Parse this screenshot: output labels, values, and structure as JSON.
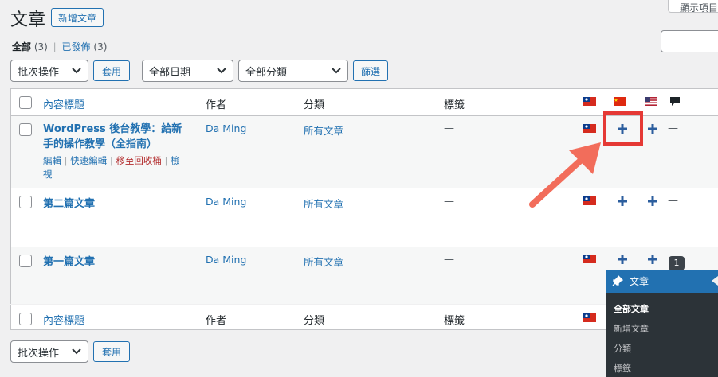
{
  "header": {
    "title": "文章",
    "add_new": "新增文章",
    "screen_options": "顯示項目"
  },
  "subsubsub": {
    "all_label": "全部",
    "all_count": "(3)",
    "sep": "|",
    "published_label": "已發佈",
    "published_count": "(3)"
  },
  "filters_top": {
    "bulk_action": "批次操作",
    "apply": "套用",
    "date": "全部日期",
    "category": "全部分類",
    "filter": "篩選"
  },
  "table": {
    "col_title": "內容標題",
    "col_author": "作者",
    "col_categories": "分類",
    "col_tags": "標籤",
    "rows": [
      {
        "title": "WordPress 後台教學：給新手的操作教學（全指南）",
        "author": "Da Ming",
        "category": "所有文章",
        "tags": "—",
        "actions": {
          "edit": "編輯",
          "quick_edit": "快速編輯",
          "trash": "移至回收桶",
          "view": "檢視"
        },
        "extra": "—"
      },
      {
        "title": "第二篇文章",
        "author": "Da Ming",
        "category": "所有文章",
        "tags": "—",
        "extra": "—"
      },
      {
        "title": "第一篇文章",
        "author": "Da Ming",
        "category": "所有文章",
        "tags": "—",
        "badge": "1"
      }
    ]
  },
  "filters_bottom": {
    "bulk_action": "批次操作",
    "apply": "套用"
  },
  "flyout": {
    "header": "文章",
    "items": [
      "全部文章",
      "新增文章",
      "分類",
      "標籤"
    ]
  },
  "colors": {
    "link": "#2271b1",
    "highlight": "#e53935",
    "admin_menu": "#2c3338",
    "admin_active": "#2271b1"
  }
}
